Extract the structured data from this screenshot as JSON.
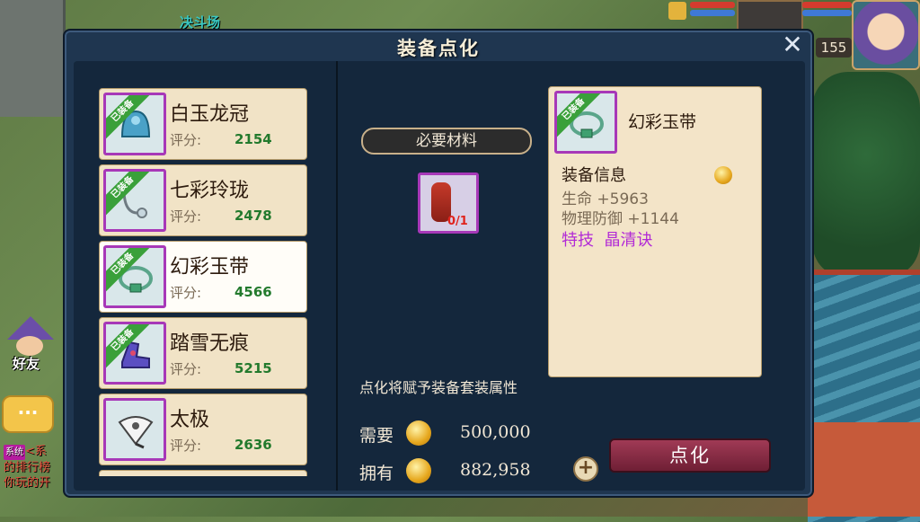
{
  "background": {
    "arena_label": "决斗场"
  },
  "hud": {
    "level": "155"
  },
  "side": {
    "friend_label": "好友",
    "chat_dots": "···",
    "chat_tag": "系统",
    "chat_lines": [
      "<系",
      "的排行榜",
      "你玩的开"
    ]
  },
  "dialog": {
    "title": "装备点化",
    "close_icon": "close-icon",
    "equipped_tag": "已装备",
    "score_label": "评分:",
    "items": [
      {
        "name": "白玉龙冠",
        "score": "2154",
        "icon": "crown-icon"
      },
      {
        "name": "七彩玲珑",
        "score": "2478",
        "icon": "necklace-icon"
      },
      {
        "name": "幻彩玉带",
        "score": "4566",
        "icon": "belt-icon",
        "selected": true
      },
      {
        "name": "踏雪无痕",
        "score": "5215",
        "icon": "boots-icon"
      },
      {
        "name": "太极",
        "score": "2636",
        "icon": "fan-icon"
      }
    ],
    "required_title": "必要材料",
    "material": {
      "icon": "potion-bottle-icon",
      "count": "0/1"
    },
    "description": "点化将赋予装备套装属性",
    "cost": {
      "need_label": "需要",
      "need_value": "500,000",
      "have_label": "拥有",
      "have_value": "882,958"
    },
    "action_button": "点化",
    "detail": {
      "name": "幻彩玉带",
      "info_title": "装备信息",
      "stats": [
        {
          "label": "生命",
          "value": "+5963"
        },
        {
          "label": "物理防御",
          "value": "+1144"
        }
      ],
      "skill": "特技  晶清诀"
    }
  }
}
